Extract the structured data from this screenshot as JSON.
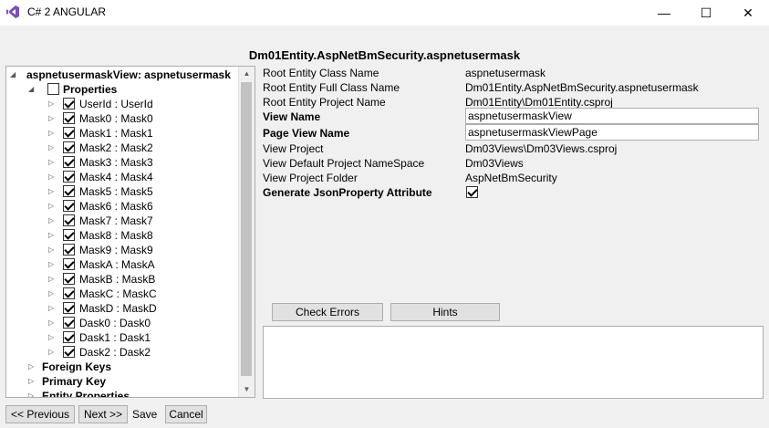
{
  "window": {
    "title": "C# 2 ANGULAR",
    "minimize": "—",
    "maximize": "☐",
    "close": "✕",
    "icon": "visual-studio-icon"
  },
  "header": {
    "title": "Dm01Entity.AspNetBmSecurity.aspnetusermask"
  },
  "tree": {
    "root": "aspnetusermaskView: aspnetusermask",
    "properties_label": "Properties",
    "items": [
      "UserId : UserId",
      "Mask0 : Mask0",
      "Mask1 : Mask1",
      "Mask2 : Mask2",
      "Mask3 : Mask3",
      "Mask4 : Mask4",
      "Mask5 : Mask5",
      "Mask6 : Mask6",
      "Mask7 : Mask7",
      "Mask8 : Mask8",
      "Mask9 : Mask9",
      "MaskA : MaskA",
      "MaskB : MaskB",
      "MaskC : MaskC",
      "MaskD : MaskD",
      "Dask0 : Dask0",
      "Dask1 : Dask1",
      "Dask2 : Dask2"
    ],
    "foreign_keys": "Foreign Keys",
    "primary_key": "Primary Key",
    "entity_properties": "Entity Properties"
  },
  "props": {
    "root_class_label": "Root Entity Class Name",
    "root_class_value": "aspnetusermask",
    "root_full_label": "Root Entity Full Class Name",
    "root_full_value": "Dm01Entity.AspNetBmSecurity.aspnetusermask",
    "root_project_label": "Root Entity Project Name",
    "root_project_value": "Dm01Entity\\Dm01Entity.csproj",
    "view_name_label": "View Name",
    "view_name_value": "aspnetusermaskView",
    "page_view_label": "Page View Name",
    "page_view_value": "aspnetusermaskViewPage",
    "view_project_label": "View Project",
    "view_project_value": "Dm03Views\\Dm03Views.csproj",
    "view_ns_label": "View Default Project NameSpace",
    "view_ns_value": "Dm03Views",
    "view_folder_label": "View Project Folder",
    "view_folder_value": "AspNetBmSecurity",
    "json_attr_label": "Generate JsonProperty Attribute"
  },
  "buttons": {
    "check_errors": "Check Errors",
    "hints": "Hints",
    "previous": "<< Previous",
    "next": "Next >>",
    "save": "Save",
    "cancel": "Cancel"
  }
}
